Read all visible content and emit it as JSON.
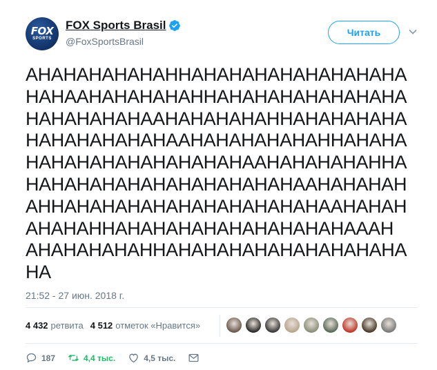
{
  "author": {
    "display_name": "FOX Sports Brasil",
    "handle": "@FoxSportsBrasil",
    "avatar_text_main": "FOX",
    "avatar_text_sub": "SPORTS",
    "verified": true
  },
  "follow_button": {
    "label": "Читать"
  },
  "tweet": {
    "lines": [
      "AHAHAHAHAHAHHAHAHAHAHAHAHAHAHA",
      "HAHAAHAHAHAHAHHAHAHAHAHAHAHAHA",
      "HAHAHAHAHAAHAHAHAHAHHAHAHAHAHA",
      "HAHAHAHAHAHAAHAHAHAHAHAHHAHAHA",
      "HAHAHAHAHAHAHAHAHAAHAHAHAHAHHA",
      "HAHAHAHAHAHAHAHAHAHAHAAHAHAHAH",
      "AHHAHAHAHAHAHAHAHAHAHAHAAHAHAH",
      "AHAHAHHAHAHAHAHAHAHAHAHAHAAAH",
      "AHAHAHAHAHHAHAHAHAHAHAHAHAHAHA",
      "HA"
    ],
    "timestamp": "21:52 - 27 июн. 2018 г."
  },
  "stats": {
    "retweets_count": "4 432",
    "retweets_label": "ретвита",
    "likes_count": "4 512",
    "likes_label": "отметок «Нравится»"
  },
  "likers": [
    "#6b5a4e",
    "#2b2b2b",
    "#3a3a3a",
    "#b8a68e",
    "#8a8f7a",
    "#5a6b5a",
    "#c0392b",
    "#4a3a2a",
    "#7a7a7a"
  ],
  "actions": {
    "replies": "187",
    "retweets": "4,4 тыс.",
    "likes": "4,5 тыс."
  },
  "colors": {
    "accent": "#1da1f2",
    "retweet_green": "#17bf63",
    "muted": "#657786"
  }
}
